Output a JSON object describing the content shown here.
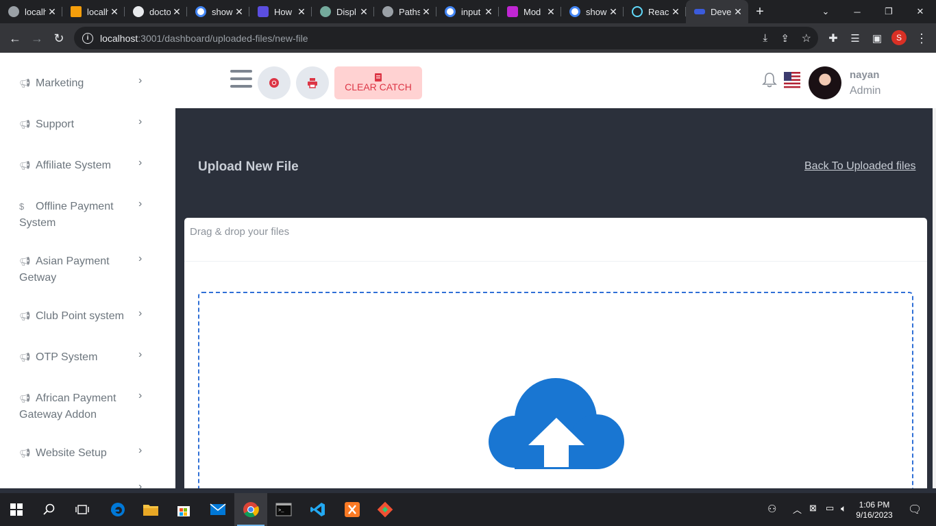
{
  "browser": {
    "tabs": [
      {
        "title": "localh",
        "favicon_color": "#9aa0a6"
      },
      {
        "title": "localh",
        "favicon_color": "#f59e0b"
      },
      {
        "title": "docto",
        "favicon_color": "#e8eaed"
      },
      {
        "title": "show",
        "favicon_color": "#4285f4"
      },
      {
        "title": "How",
        "favicon_color": "#5b4ee0"
      },
      {
        "title": "Displ",
        "favicon_color": "#74aa9c"
      },
      {
        "title": "Paths",
        "favicon_color": "#9aa0a6"
      },
      {
        "title": "input",
        "favicon_color": "#4285f4"
      },
      {
        "title": "Mod",
        "favicon_color": "#c026d3"
      },
      {
        "title": "show",
        "favicon_color": "#4285f4"
      },
      {
        "title": "Reac",
        "favicon_color": "#61dafb"
      },
      {
        "title": "Deve",
        "favicon_color": "#3b5bdb"
      }
    ],
    "url_host": "localhost",
    "url_path": ":3001/dashboard/uploaded-files/new-file",
    "profile_initial": "S"
  },
  "sidebar": {
    "items": [
      {
        "label": "Marketing",
        "icon": "megaphone-icon"
      },
      {
        "label": "Support",
        "icon": "megaphone-icon"
      },
      {
        "label": "Affiliate System",
        "icon": "megaphone-icon"
      },
      {
        "label": "Offline Payment",
        "label2": "System",
        "icon": "dollar-icon"
      },
      {
        "label": "Asian Payment",
        "label2": "Getway",
        "icon": "megaphone-icon"
      },
      {
        "label": "Club Point system",
        "icon": "megaphone-icon"
      },
      {
        "label": "OTP System",
        "icon": "megaphone-icon"
      },
      {
        "label": "African Payment",
        "label2": "Gateway Addon",
        "icon": "megaphone-icon"
      },
      {
        "label": "Website Setup",
        "icon": "megaphone-icon"
      }
    ]
  },
  "header": {
    "clear_cache_label": "CLEAR CATCH",
    "user_name": "nayan",
    "user_role": "Admin"
  },
  "main": {
    "title": "Upload New File",
    "back_link": "Back To Uploaded files",
    "card_title": "Drag & drop your files"
  },
  "taskbar": {
    "time": "1:06 PM",
    "date": "9/16/2023"
  },
  "colors": {
    "content_bg": "#2b303b",
    "accent_blue": "#1976d2",
    "clear_btn_bg": "#ffd2d2",
    "clear_btn_text": "#dc3545"
  }
}
